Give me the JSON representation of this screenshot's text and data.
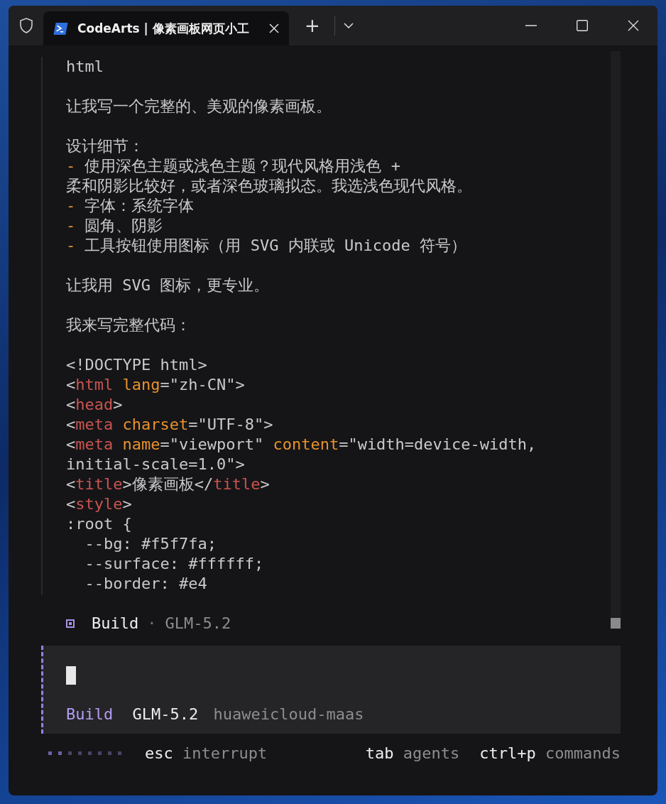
{
  "window": {
    "tab_title": "CodeArts | 像素画板网页小工",
    "new_tab": "+"
  },
  "transcript": {
    "lines": [
      {
        "kind": "text",
        "segments": [
          {
            "kind": "plain",
            "text": "html"
          }
        ]
      },
      {
        "kind": "gap"
      },
      {
        "kind": "text",
        "segments": [
          {
            "kind": "plain",
            "text": "让我写一个完整的、美观的像素画板。"
          }
        ]
      },
      {
        "kind": "gap"
      },
      {
        "kind": "text",
        "segments": [
          {
            "kind": "plain",
            "text": "设计细节："
          }
        ]
      },
      {
        "kind": "text",
        "segments": [
          {
            "kind": "marker",
            "text": "-"
          },
          {
            "kind": "plain",
            "text": " 使用深色主题或浅色主题？现代风格用浅色 +"
          }
        ]
      },
      {
        "kind": "text",
        "segments": [
          {
            "kind": "plain",
            "text": "柔和阴影比较好，或者深色玻璃拟态。我选浅色现代风格。"
          }
        ]
      },
      {
        "kind": "text",
        "segments": [
          {
            "kind": "marker",
            "text": "-"
          },
          {
            "kind": "plain",
            "text": " 字体：系统字体"
          }
        ]
      },
      {
        "kind": "text",
        "segments": [
          {
            "kind": "marker",
            "text": "-"
          },
          {
            "kind": "plain",
            "text": " 圆角、阴影"
          }
        ]
      },
      {
        "kind": "text",
        "segments": [
          {
            "kind": "marker",
            "text": "-"
          },
          {
            "kind": "plain",
            "text": " 工具按钮使用图标（用 SVG 内联或 Unicode 符号）"
          }
        ]
      },
      {
        "kind": "gap"
      },
      {
        "kind": "text",
        "segments": [
          {
            "kind": "plain",
            "text": "让我用 SVG 图标，更专业。"
          }
        ]
      },
      {
        "kind": "gap"
      },
      {
        "kind": "text",
        "segments": [
          {
            "kind": "plain",
            "text": "我来写完整代码："
          }
        ]
      },
      {
        "kind": "gap"
      },
      {
        "kind": "code",
        "segments": [
          {
            "kind": "plain",
            "text": "<!DOCTYPE html>"
          }
        ]
      },
      {
        "kind": "code",
        "segments": [
          {
            "kind": "plain",
            "text": "<"
          },
          {
            "kind": "tag",
            "text": "html"
          },
          {
            "kind": "attr",
            "text": " lang"
          },
          {
            "kind": "plain",
            "text": "=\"zh-CN\">"
          }
        ]
      },
      {
        "kind": "code",
        "segments": [
          {
            "kind": "plain",
            "text": "<"
          },
          {
            "kind": "tag",
            "text": "head"
          },
          {
            "kind": "plain",
            "text": ">"
          }
        ]
      },
      {
        "kind": "code",
        "segments": [
          {
            "kind": "plain",
            "text": "<"
          },
          {
            "kind": "tag",
            "text": "meta"
          },
          {
            "kind": "attr",
            "text": " charset"
          },
          {
            "kind": "plain",
            "text": "=\"UTF-8\">"
          }
        ]
      },
      {
        "kind": "code",
        "segments": [
          {
            "kind": "plain",
            "text": "<"
          },
          {
            "kind": "tag",
            "text": "meta"
          },
          {
            "kind": "attr",
            "text": " name"
          },
          {
            "kind": "plain",
            "text": "=\"viewport\" "
          },
          {
            "kind": "attr",
            "text": "content"
          },
          {
            "kind": "plain",
            "text": "=\"width=device-width,"
          }
        ]
      },
      {
        "kind": "code",
        "segments": [
          {
            "kind": "plain",
            "text": "initial-scale=1.0\">"
          }
        ]
      },
      {
        "kind": "code",
        "segments": [
          {
            "kind": "plain",
            "text": "<"
          },
          {
            "kind": "tag",
            "text": "title"
          },
          {
            "kind": "plain",
            "text": ">像素画板</"
          },
          {
            "kind": "tag",
            "text": "title"
          },
          {
            "kind": "plain",
            "text": ">"
          }
        ]
      },
      {
        "kind": "code",
        "segments": [
          {
            "kind": "plain",
            "text": "<"
          },
          {
            "kind": "tag",
            "text": "style"
          },
          {
            "kind": "plain",
            "text": ">"
          }
        ]
      },
      {
        "kind": "code",
        "segments": [
          {
            "kind": "plain",
            "text": ":root {"
          }
        ]
      },
      {
        "kind": "code",
        "segments": [
          {
            "kind": "plain",
            "text": "  --bg: #f5f7fa;"
          }
        ]
      },
      {
        "kind": "code",
        "segments": [
          {
            "kind": "plain",
            "text": "  --surface: #ffffff;"
          }
        ]
      },
      {
        "kind": "code",
        "segments": [
          {
            "kind": "plain",
            "text": "  --border: #e4"
          }
        ]
      }
    ],
    "status": {
      "agent": "Build",
      "separator": "·",
      "model": "GLM-5.2"
    }
  },
  "prompt": {
    "mode": "Build",
    "model": "GLM-5.2",
    "provider": "huaweicloud-maas"
  },
  "hints": [
    {
      "key": "esc",
      "action": "interrupt"
    },
    {
      "key": "tab",
      "action": "agents"
    },
    {
      "key": "ctrl+p",
      "action": "commands"
    }
  ]
}
